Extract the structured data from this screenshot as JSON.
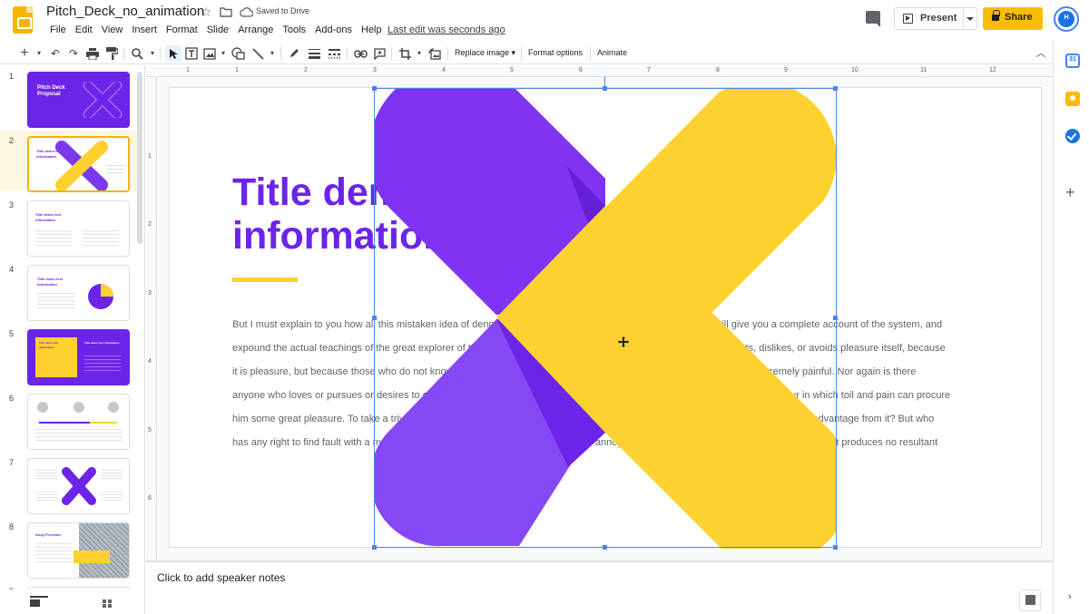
{
  "header": {
    "doc_title": "Pitch_Deck_no_animation",
    "save_status": "Saved to Drive",
    "last_edit": "Last edit was seconds ago",
    "present_label": "Present",
    "share_label": "Share",
    "avatar_initials": "H",
    "menu": [
      "File",
      "Edit",
      "View",
      "Insert",
      "Format",
      "Slide",
      "Arrange",
      "Tools",
      "Add-ons",
      "Help"
    ]
  },
  "toolbar": {
    "replace_image": "Replace image",
    "format_options": "Format options",
    "animate": "Animate"
  },
  "ruler": {
    "top": [
      "1",
      "1",
      "2",
      "3",
      "4",
      "5",
      "6",
      "7",
      "8",
      "9",
      "10",
      "11",
      "12"
    ],
    "left": [
      "1",
      "2",
      "3",
      "4",
      "5",
      "6"
    ]
  },
  "filmstrip": {
    "slides": [
      {
        "number": "1",
        "title": "Pitch Deck Proposal"
      },
      {
        "number": "2",
        "title": "Title demo text information"
      },
      {
        "number": "3",
        "title": "Title demo text information"
      },
      {
        "number": "4",
        "title": "Title demo text information"
      },
      {
        "number": "5",
        "title": "Title demo text information"
      },
      {
        "number": "6",
        "title": ""
      },
      {
        "number": "7",
        "title": ""
      },
      {
        "number": "8",
        "title": "Andy Freeman"
      },
      {
        "number": "9",
        "title": ""
      }
    ]
  },
  "slide": {
    "title_line1": "Title demo",
    "title_line2": "information",
    "body_lines": [
      "But I must explain to you how all this mistaken idea of denouncing pleasure and praising pain was born and I will give you a complete account of the system, and",
      "expound the actual teachings of the great explorer of the truth, the master-builder of human happiness. No one rejects, dislikes, or avoids pleasure itself, because",
      "it is pleasure, but because those who do not know how to pursue pleasure rationally encounter consequences that are extremely painful. Nor again is there",
      "anyone who loves or pursues or desires to obtain pain of itself, because it is pain, but because occasionally circumstances occur in which toil and pain can procure",
      "him some great pleasure. To take a trivial example, which of us ever undertakes laborious physical exercise, except to obtain some advantage from it? But who",
      "has any right to find fault with a man who chooses to enjoy a pleasure that has no annoying consequences, or one who avoids a pain that produces no resultant"
    ],
    "colors": {
      "purple": "#6c24e8",
      "yellow": "#fdd12f"
    }
  },
  "notes": {
    "placeholder": "Click to add speaker notes"
  }
}
